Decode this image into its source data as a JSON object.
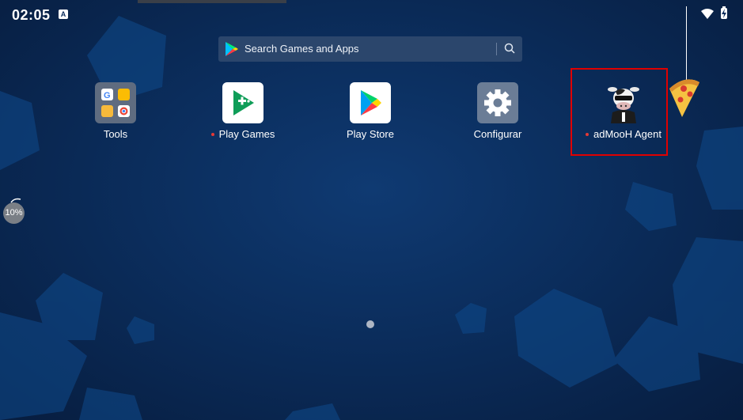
{
  "status_bar": {
    "time": "02:05",
    "notification_badge": "A",
    "wifi_icon": "wifi-icon",
    "battery_icon": "battery-charging-icon"
  },
  "search": {
    "placeholder": "Search Games and Apps",
    "logo_icon": "play-store-logo-icon",
    "action_icon": "search-icon"
  },
  "apps": [
    {
      "label": "Tools",
      "icon": "folder-icon",
      "has_dot": false
    },
    {
      "label": "Play Games",
      "icon": "play-games-icon",
      "has_dot": true
    },
    {
      "label": "Play Store",
      "icon": "play-store-icon",
      "has_dot": false
    },
    {
      "label": "Configurar",
      "icon": "settings-gear-icon",
      "has_dot": false
    },
    {
      "label": "adMooH Agent",
      "icon": "cow-mascot-icon",
      "has_dot": true,
      "highlighted": true
    }
  ],
  "widgets": {
    "progress_percent": "10%",
    "pizza_icon": "pizza-slice-icon"
  },
  "pager": {
    "current_page": 1,
    "total_pages": 1
  },
  "colors": {
    "background": "#0b2d5c",
    "highlight": "#e00000",
    "notification_dot": "#e53935",
    "search_bar": "#2b466c"
  }
}
